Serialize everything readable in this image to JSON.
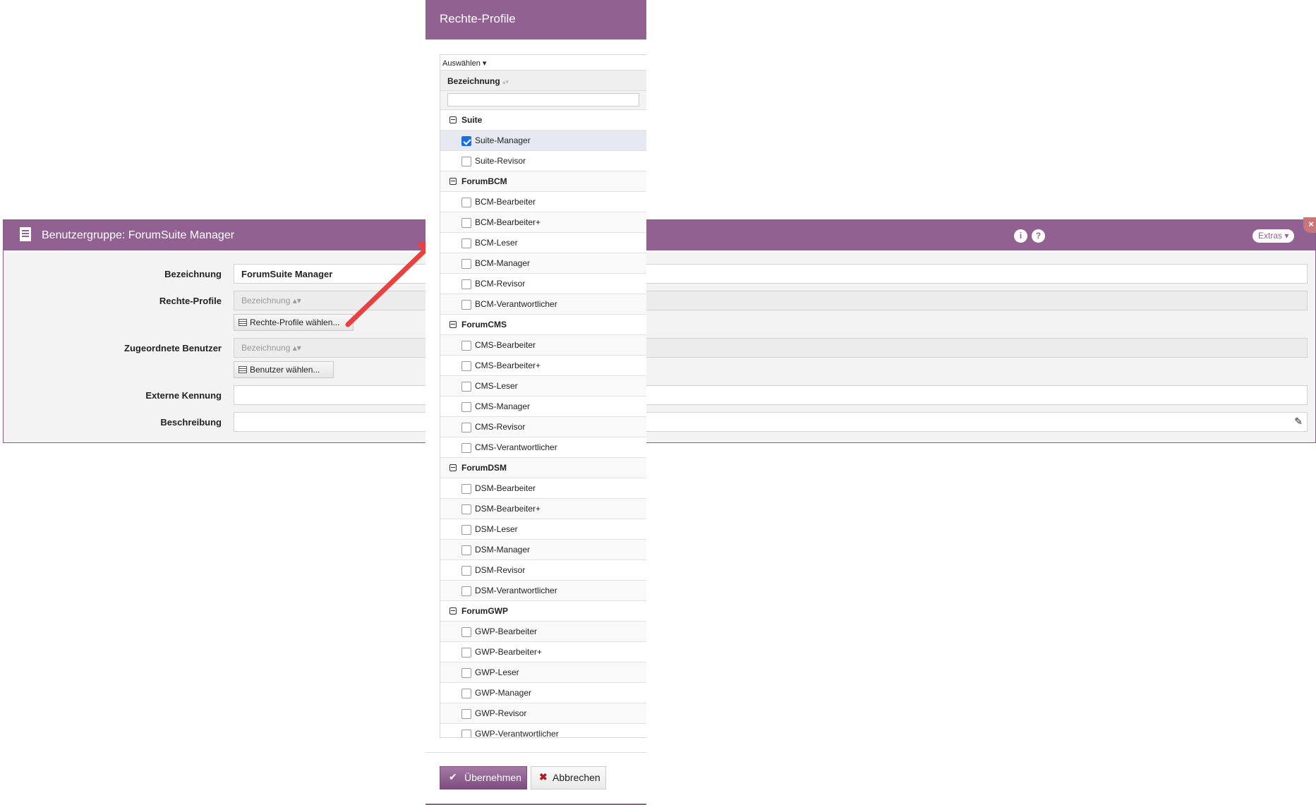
{
  "dialog": {
    "title": "Benutzergruppe: ForumSuite Manager",
    "info": "i",
    "help": "?",
    "extras": "Extras ▾",
    "close": "×",
    "fields": {
      "bezeichnung_label": "Bezeichnung",
      "bezeichnung_value": "ForumSuite Manager",
      "rechte_label": "Rechte-Profile",
      "rechte_col": "Bezeichnung ▴▾",
      "rechte_button": "Rechte-Profile wählen...",
      "benutzer_label": "Zugeordnete Benutzer",
      "benutzer_col": "Bezeichnung ▴▾",
      "benutzer_button": "Benutzer wählen...",
      "extern_label": "Externe Kennung",
      "beschreibung_label": "Beschreibung"
    }
  },
  "modal": {
    "title": "Rechte-Profile",
    "select_menu": "Auswählen ▾",
    "column": "Bezeichnung",
    "sort": "▴▾",
    "groups": [
      {
        "name": "Suite",
        "items": [
          {
            "label": "Suite-Manager",
            "checked": true
          },
          {
            "label": "Suite-Revisor",
            "checked": false
          }
        ]
      },
      {
        "name": "ForumBCM",
        "items": [
          {
            "label": "BCM-Bearbeiter",
            "checked": false
          },
          {
            "label": "BCM-Bearbeiter+",
            "checked": false
          },
          {
            "label": "BCM-Leser",
            "checked": false
          },
          {
            "label": "BCM-Manager",
            "checked": false
          },
          {
            "label": "BCM-Revisor",
            "checked": false
          },
          {
            "label": "BCM-Verantwortlicher",
            "checked": false
          }
        ]
      },
      {
        "name": "ForumCMS",
        "items": [
          {
            "label": "CMS-Bearbeiter",
            "checked": false
          },
          {
            "label": "CMS-Bearbeiter+",
            "checked": false
          },
          {
            "label": "CMS-Leser",
            "checked": false
          },
          {
            "label": "CMS-Manager",
            "checked": false
          },
          {
            "label": "CMS-Revisor",
            "checked": false
          },
          {
            "label": "CMS-Verantwortlicher",
            "checked": false
          }
        ]
      },
      {
        "name": "ForumDSM",
        "items": [
          {
            "label": "DSM-Bearbeiter",
            "checked": false
          },
          {
            "label": "DSM-Bearbeiter+",
            "checked": false
          },
          {
            "label": "DSM-Leser",
            "checked": false
          },
          {
            "label": "DSM-Manager",
            "checked": false
          },
          {
            "label": "DSM-Revisor",
            "checked": false
          },
          {
            "label": "DSM-Verantwortlicher",
            "checked": false
          }
        ]
      },
      {
        "name": "ForumGWP",
        "items": [
          {
            "label": "GWP-Bearbeiter",
            "checked": false
          },
          {
            "label": "GWP-Bearbeiter+",
            "checked": false
          },
          {
            "label": "GWP-Leser",
            "checked": false
          },
          {
            "label": "GWP-Manager",
            "checked": false
          },
          {
            "label": "GWP-Revisor",
            "checked": false
          },
          {
            "label": "GWP-Verantwortlicher",
            "checked": false
          }
        ]
      }
    ],
    "ok": "Übernehmen",
    "cancel": "Abbrechen"
  },
  "colors": {
    "brand": "#916192",
    "arrow": "#e8413f",
    "checked": "#1a6fe0"
  }
}
